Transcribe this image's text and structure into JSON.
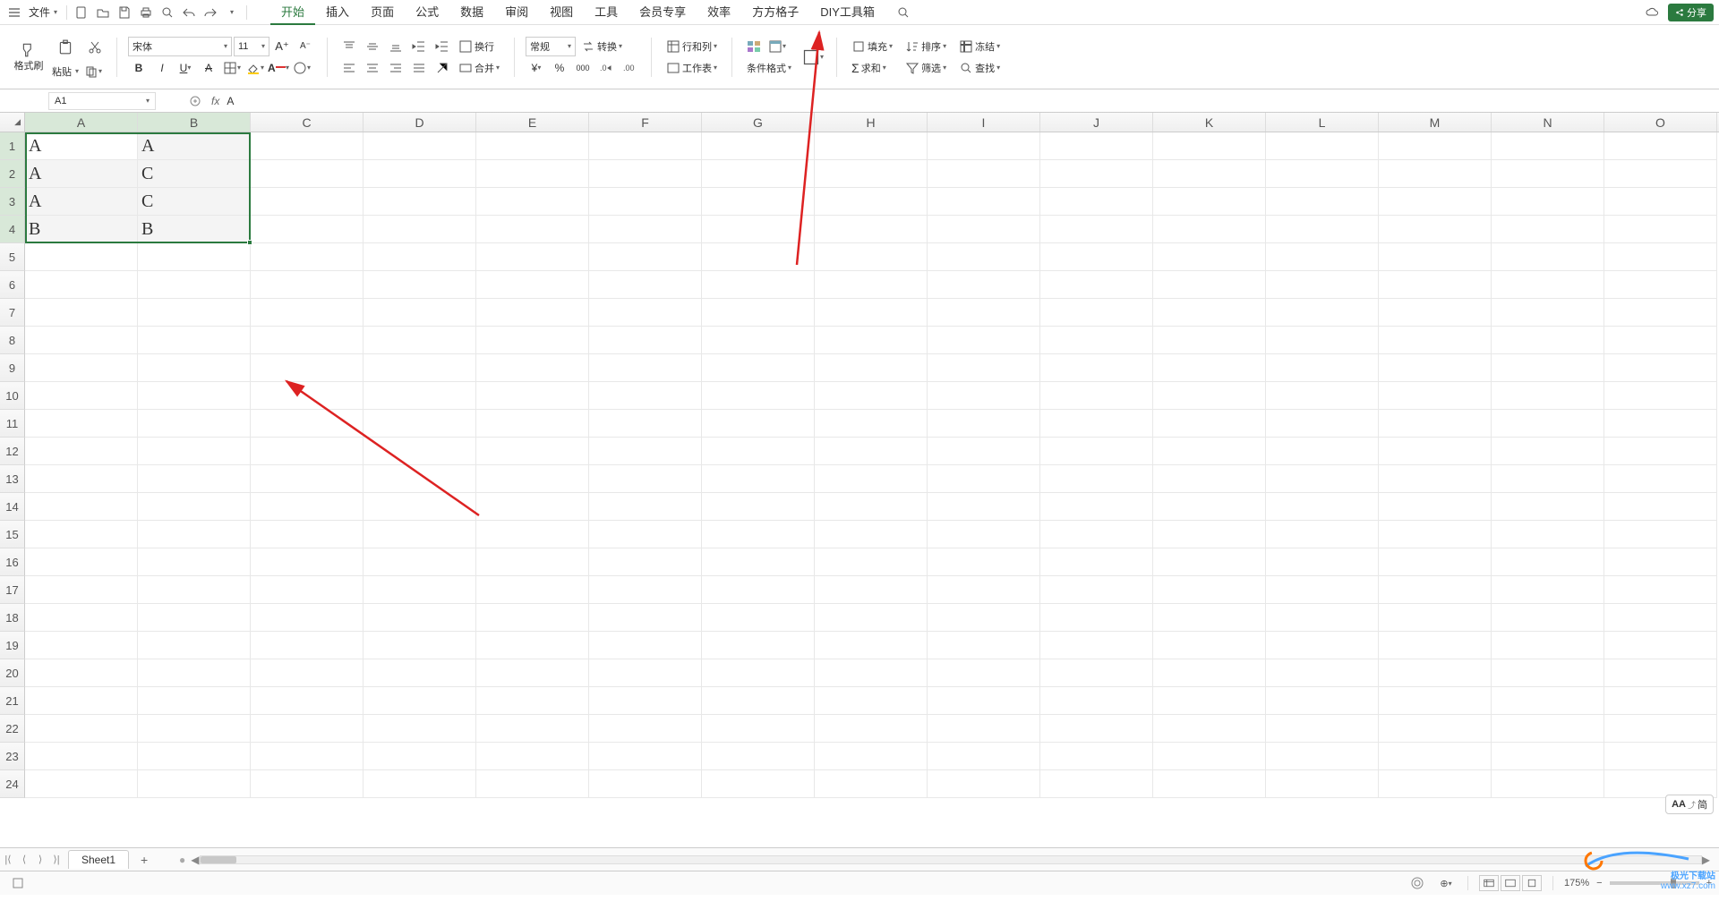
{
  "top": {
    "file": "文件",
    "qa_icons": [
      "new",
      "open",
      "save",
      "print",
      "preview",
      "undo",
      "redo",
      "more"
    ],
    "tabs": [
      "开始",
      "插入",
      "页面",
      "公式",
      "数据",
      "审阅",
      "视图",
      "工具",
      "会员专享",
      "效率",
      "方方格子",
      "DIY工具箱"
    ],
    "active_tab": 0,
    "share": "分享"
  },
  "ribbon": {
    "format_painter": "格式刷",
    "paste": "粘贴",
    "font_name": "宋体",
    "font_size": "11",
    "number_format": "常规",
    "convert": "转换",
    "row_col": "行和列",
    "worksheet": "工作表",
    "wrap": "换行",
    "merge": "合并",
    "cond_fmt": "条件格式",
    "fill": "填充",
    "sort": "排序",
    "freeze": "冻结",
    "sum": "求和",
    "filter": "筛选",
    "find": "查找"
  },
  "fx": {
    "name_box": "A1",
    "formula": "A"
  },
  "grid": {
    "columns": [
      "A",
      "B",
      "C",
      "D",
      "E",
      "F",
      "G",
      "H",
      "I",
      "J",
      "K",
      "L",
      "M",
      "N",
      "O"
    ],
    "rows": 24,
    "selected_cols": 2,
    "selected_rows": 4,
    "data": [
      [
        "A",
        "A"
      ],
      [
        "A",
        "C"
      ],
      [
        "A",
        "C"
      ],
      [
        "B",
        "B"
      ]
    ]
  },
  "sheets": {
    "active": "Sheet1"
  },
  "status": {
    "zoom": "175%",
    "aa": "AA",
    "aa_sub": "简"
  },
  "watermark": {
    "line1": "极光下载站",
    "line2": "www.xz7.com"
  }
}
